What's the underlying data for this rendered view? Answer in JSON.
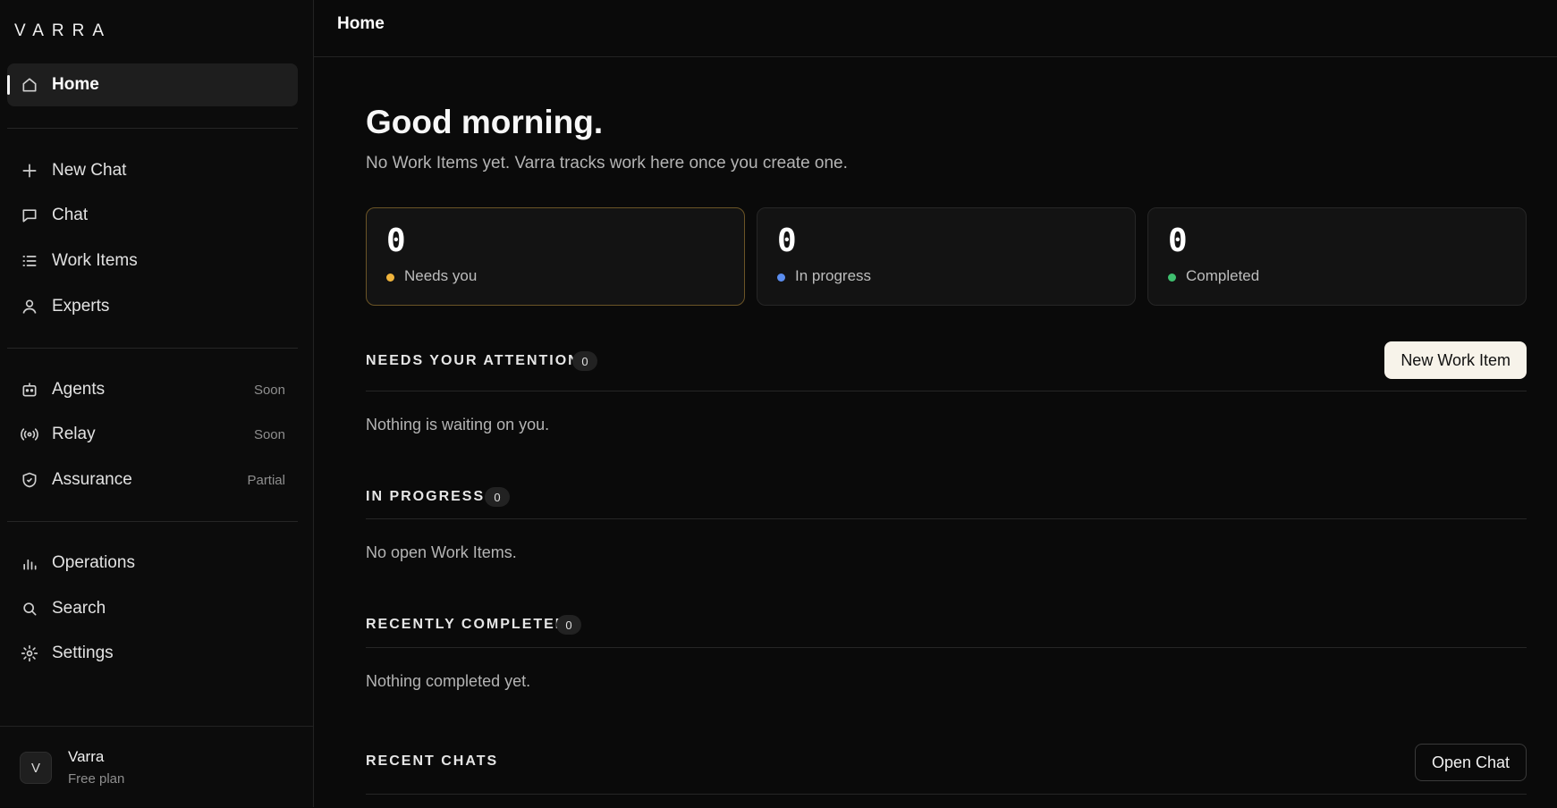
{
  "brand": {
    "logo": "VARRA"
  },
  "sidebar": {
    "primary": [
      {
        "label": "Home",
        "icon": "home-icon",
        "active": true
      }
    ],
    "group1": [
      {
        "label": "New Chat",
        "icon": "plus-icon"
      },
      {
        "label": "Chat",
        "icon": "chat-bubble-icon"
      },
      {
        "label": "Work Items",
        "icon": "list-icon"
      },
      {
        "label": "Experts",
        "icon": "user-icon"
      }
    ],
    "group2": [
      {
        "label": "Agents",
        "icon": "robot-icon",
        "badge": "Soon"
      },
      {
        "label": "Relay",
        "icon": "broadcast-icon",
        "badge": "Soon"
      },
      {
        "label": "Assurance",
        "icon": "shield-check-icon",
        "badge": "Partial"
      }
    ],
    "group3": [
      {
        "label": "Operations",
        "icon": "bar-chart-icon"
      },
      {
        "label": "Search",
        "icon": "search-icon"
      },
      {
        "label": "Settings",
        "icon": "gear-icon"
      }
    ],
    "user": {
      "initial": "V",
      "name": "Varra",
      "plan": "Free plan"
    }
  },
  "topbar": {
    "title": "Home"
  },
  "main": {
    "greeting": "Good morning.",
    "subtitle": "No Work Items yet. Varra tracks work here once you create one.",
    "stats": [
      {
        "value": "0",
        "label": "Needs you",
        "color": "#f0b43c"
      },
      {
        "value": "0",
        "label": "In progress",
        "color": "#5b8def"
      },
      {
        "value": "0",
        "label": "Completed",
        "color": "#3fbf6f"
      }
    ],
    "sections": {
      "attention": {
        "title": "NEEDS YOUR ATTENTION",
        "count": "0",
        "empty": "Nothing is waiting on you.",
        "action": "New Work Item"
      },
      "progress": {
        "title": "IN PROGRESS",
        "count": "0",
        "empty": "No open Work Items."
      },
      "completed": {
        "title": "RECENTLY COMPLETED",
        "count": "0",
        "empty": "Nothing completed yet."
      },
      "chats": {
        "title": "RECENT CHATS",
        "action": "Open Chat"
      }
    }
  },
  "colors": {
    "background": "#0a0a0a",
    "accent_highlight": "#6b5426",
    "primary_button": "#f7f3ea"
  }
}
